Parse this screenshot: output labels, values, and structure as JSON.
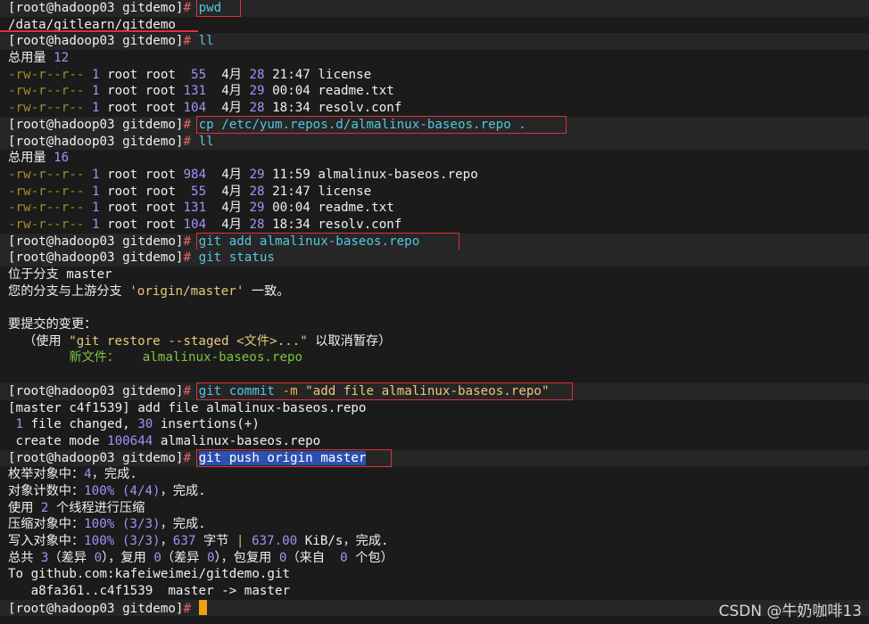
{
  "prompt": "[root@hadoop03 gitdemo]",
  "hash": "#",
  "lines": [
    {
      "kind": "cmd",
      "cmd": "pwd",
      "box": [
        220,
        0,
        270
      ],
      "hl": true
    },
    {
      "kind": "out",
      "text": "/data/gitlearn/gitdemo"
    },
    {
      "kind": "cmd",
      "cmd": "ll"
    },
    {
      "kind": "total",
      "label": "总用量",
      "value": "12"
    },
    {
      "kind": "ls",
      "perm": "-rw-r--r--",
      "links": "1",
      "owner": "root root",
      "size": " 55",
      "month": "4月",
      "day": "28",
      "time": "21:47",
      "name": "license"
    },
    {
      "kind": "ls",
      "perm": "-rw-r--r--",
      "links": "1",
      "owner": "root root",
      "size": "131",
      "month": "4月",
      "day": "29",
      "time": "00:04",
      "name": "readme.txt"
    },
    {
      "kind": "ls",
      "perm": "-rw-r--r--",
      "links": "1",
      "owner": "root root",
      "size": "104",
      "month": "4月",
      "day": "28",
      "time": "18:34",
      "name": "resolv.conf"
    },
    {
      "kind": "cmd",
      "cmd": "cp /etc/yum.repos.d/almalinux-baseos.repo .",
      "box": [
        220,
        0,
        635
      ]
    },
    {
      "kind": "cmd",
      "cmd": "ll"
    },
    {
      "kind": "total",
      "label": "总用量",
      "value": "16"
    },
    {
      "kind": "ls",
      "perm": "-rw-r--r--",
      "links": "1",
      "owner": "root root",
      "size": "984",
      "month": "4月",
      "day": "29",
      "time": "11:59",
      "name": "almalinux-baseos.repo"
    },
    {
      "kind": "ls",
      "perm": "-rw-r--r--",
      "links": "1",
      "owner": "root root",
      "size": " 55",
      "month": "4月",
      "day": "28",
      "time": "21:47",
      "name": "license"
    },
    {
      "kind": "ls",
      "perm": "-rw-r--r--",
      "links": "1",
      "owner": "root root",
      "size": "131",
      "month": "4月",
      "day": "29",
      "time": "00:04",
      "name": "readme.txt"
    },
    {
      "kind": "ls",
      "perm": "-rw-r--r--",
      "links": "1",
      "owner": "root root",
      "size": "104",
      "month": "4月",
      "day": "28",
      "time": "18:34",
      "name": "resolv.conf"
    },
    {
      "kind": "cmd",
      "cmd": "git add almalinux-baseos.repo",
      "box": [
        220,
        0,
        515
      ]
    },
    {
      "kind": "cmd",
      "cmd": "git status"
    },
    {
      "kind": "out",
      "text": "位于分支 master"
    },
    {
      "kind": "branch",
      "a": "您的分支与上游分支 ",
      "b": "'origin/master'",
      "c": " 一致。"
    },
    {
      "kind": "blank"
    },
    {
      "kind": "out",
      "text": "要提交的变更："
    },
    {
      "kind": "hint",
      "a": "  （使用 ",
      "b": "\"git restore --staged <文件>...\"",
      "c": " 以取消暂存）"
    },
    {
      "kind": "newfile",
      "a": "        新文件：   ",
      "b": "almalinux-baseos.repo"
    },
    {
      "kind": "blank"
    },
    {
      "kind": "commit",
      "a": "git commit ",
      "b": "-m",
      "c": " \"add file almalinux-baseos.repo\"",
      "box": [
        220,
        0,
        642
      ]
    },
    {
      "kind": "out",
      "text": "[master c4f1539] add file almalinux-baseos.repo"
    },
    {
      "kind": "changed",
      "a": " ",
      "b": "1",
      "c": " file changed, ",
      "d": "30",
      "e": " insertions(+)"
    },
    {
      "kind": "mode",
      "a": " create mode ",
      "b": "100644",
      "c": " almalinux-baseos.repo"
    },
    {
      "kind": "push",
      "cmd": "git push origin master",
      "box": [
        220,
        0,
        439
      ]
    },
    {
      "kind": "enum",
      "a": "枚举对象中：",
      "b": "4",
      "c": "，完成."
    },
    {
      "kind": "count",
      "a": "对象计数中：",
      "b": "100%",
      "c": " ",
      "d": "(4/4)",
      "e": "，完成."
    },
    {
      "kind": "use",
      "a": "使用 ",
      "b": "2",
      "c": " 个线程进行压缩"
    },
    {
      "kind": "count",
      "a": "压缩对象中：",
      "b": "100%",
      "c": " ",
      "d": "(3/3)",
      "e": "，完成."
    },
    {
      "kind": "write",
      "a": "写入对象中：",
      "b": "100%",
      "c": " ",
      "d": "(3/3)",
      "e": "，",
      "f": "637",
      "g": " 字节 ",
      "h": "|",
      "i": " ",
      "j": "637.00",
      "k": " KiB/s，完成."
    },
    {
      "kind": "total2",
      "a": "总共 ",
      "b": "3",
      "c": "（差异 ",
      "d": "0",
      "e": "），复用 ",
      "f": "0",
      "g": "（差异 ",
      "h": "0",
      "i": "），包复用 ",
      "j": "0",
      "k": "（来自  ",
      "l": "0",
      "m": " 个包）"
    },
    {
      "kind": "out",
      "text": "To github.com:kafeiweimei/gitdemo.git"
    },
    {
      "kind": "out",
      "text": "   a8fa361..c4f1539  master -> master"
    },
    {
      "kind": "cursor"
    }
  ],
  "watermark": "CSDN @牛奶咖啡13"
}
